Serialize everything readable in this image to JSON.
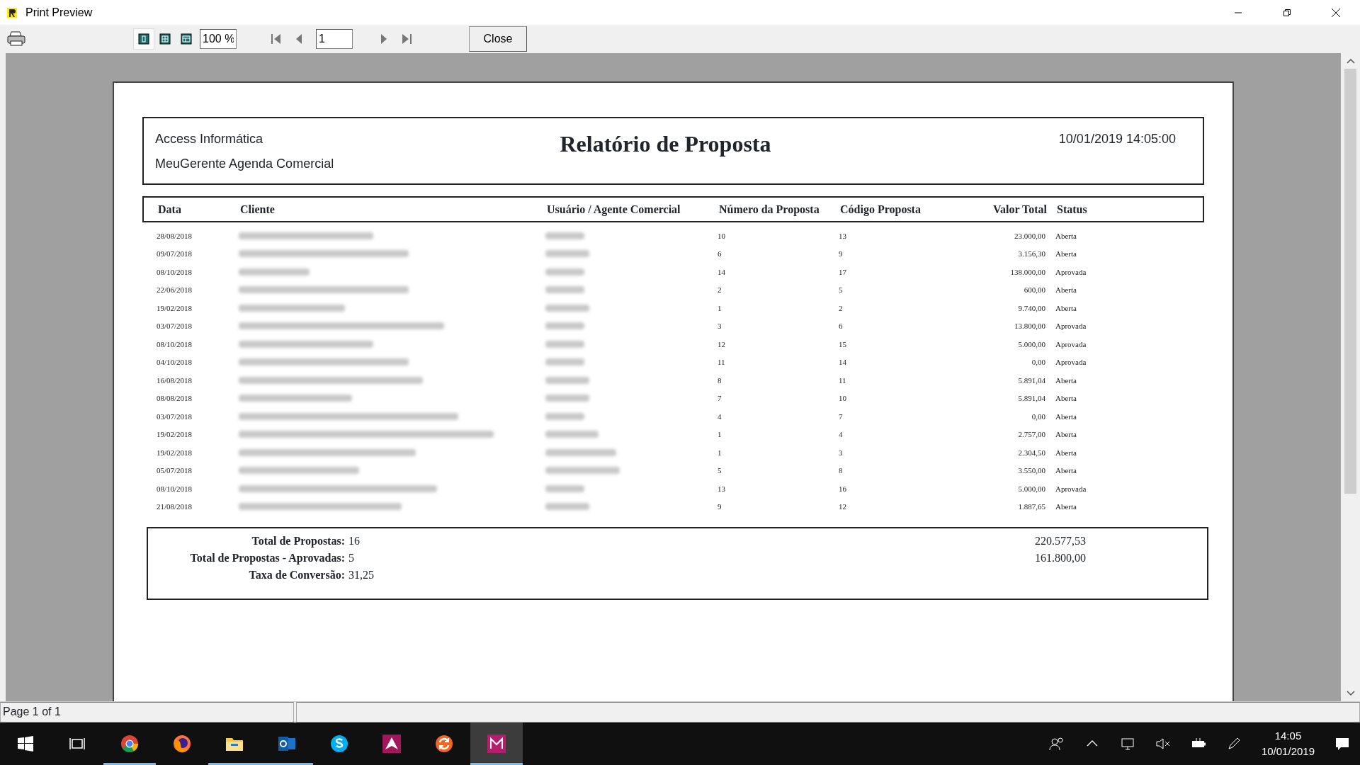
{
  "window": {
    "title": "Print Preview"
  },
  "toolbar": {
    "view_modes": [
      {
        "selected": true
      },
      {
        "selected": false
      },
      {
        "selected": false
      }
    ],
    "zoom": "100 %",
    "page": "1",
    "close": "Close"
  },
  "report": {
    "company": "Access Informática",
    "product": "MeuGerente Agenda Comercial",
    "title": "Relatório de Proposta",
    "datetime": "10/01/2019 14:05:00",
    "columns": [
      "Data",
      "Cliente",
      "Usuário / Agente Comercial",
      "Número da Proposta",
      "Código Proposta",
      "Valor Total",
      "Status"
    ],
    "rows": [
      {
        "data": "28/08/2018",
        "numero": "10",
        "codigo": "13",
        "valor": "23.000,00",
        "status": "Aberta"
      },
      {
        "data": "09/07/2018",
        "numero": "6",
        "codigo": "9",
        "valor": "3.156,30",
        "status": "Aberta"
      },
      {
        "data": "08/10/2018",
        "numero": "14",
        "codigo": "17",
        "valor": "138.000,00",
        "status": "Aprovada"
      },
      {
        "data": "22/06/2018",
        "numero": "2",
        "codigo": "5",
        "valor": "600,00",
        "status": "Aberta"
      },
      {
        "data": "19/02/2018",
        "numero": "1",
        "codigo": "2",
        "valor": "9.740,00",
        "status": "Aberta"
      },
      {
        "data": "03/07/2018",
        "numero": "3",
        "codigo": "6",
        "valor": "13.800,00",
        "status": "Aprovada"
      },
      {
        "data": "08/10/2018",
        "numero": "12",
        "codigo": "15",
        "valor": "5.000,00",
        "status": "Aprovada"
      },
      {
        "data": "04/10/2018",
        "numero": "11",
        "codigo": "14",
        "valor": "0,00",
        "status": "Aprovada"
      },
      {
        "data": "16/08/2018",
        "numero": "8",
        "codigo": "11",
        "valor": "5.891,04",
        "status": "Aberta"
      },
      {
        "data": "08/08/2018",
        "numero": "7",
        "codigo": "10",
        "valor": "5.891,04",
        "status": "Aberta"
      },
      {
        "data": "03/07/2018",
        "numero": "4",
        "codigo": "7",
        "valor": "0,00",
        "status": "Aberta"
      },
      {
        "data": "19/02/2018",
        "numero": "1",
        "codigo": "4",
        "valor": "2.757,00",
        "status": "Aberta"
      },
      {
        "data": "19/02/2018",
        "numero": "1",
        "codigo": "3",
        "valor": "2.304,50",
        "status": "Aberta"
      },
      {
        "data": "05/07/2018",
        "numero": "5",
        "codigo": "8",
        "valor": "3.550,00",
        "status": "Aberta"
      },
      {
        "data": "08/10/2018",
        "numero": "13",
        "codigo": "16",
        "valor": "5.000,00",
        "status": "Aprovada"
      },
      {
        "data": "21/08/2018",
        "numero": "9",
        "codigo": "12",
        "valor": "1.887,65",
        "status": "Aberta"
      }
    ],
    "totals": [
      {
        "label": "Total de Propostas:",
        "value": "16",
        "amount": "220.577,53"
      },
      {
        "label": "Total de Propostas - Aprovadas:",
        "value": "5",
        "amount": "161.800,00"
      },
      {
        "label": "Taxa de Conversão:",
        "value": "31,25"
      }
    ]
  },
  "status_bar": {
    "text": "Page 1 of 1"
  },
  "taskbar": {
    "apps": [
      {
        "kind": "chrome",
        "active": false,
        "running": true
      },
      {
        "kind": "firefox",
        "active": false,
        "running": false
      },
      {
        "kind": "explorer",
        "active": false,
        "running": true
      },
      {
        "kind": "outlook",
        "active": false,
        "running": true
      },
      {
        "kind": "skype",
        "active": false,
        "running": false
      },
      {
        "kind": "triangle",
        "active": false,
        "running": false
      },
      {
        "kind": "sync",
        "active": false,
        "running": false
      },
      {
        "kind": "mapp",
        "active": true,
        "running": true
      }
    ],
    "time": "14:05",
    "date": "10/01/2019"
  }
}
